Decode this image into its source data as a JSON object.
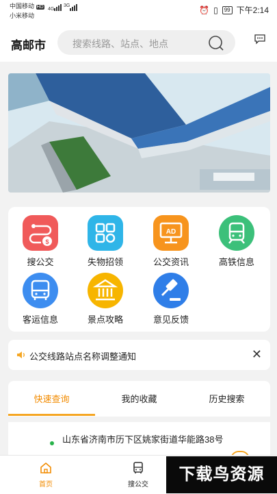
{
  "status": {
    "carrier1": "中国移动",
    "hd": "HD",
    "carrier2": "小米移动",
    "net1": "4G",
    "net2": "3G",
    "battery": "99",
    "time": "下午2:14"
  },
  "header": {
    "city": "高邮市",
    "search_placeholder": "搜索线路、站点、地点"
  },
  "grid": [
    {
      "label": "搜公交",
      "color": "#f05a5a",
      "icon": "bus-route-icon"
    },
    {
      "label": "失物招领",
      "color": "#2fb5e8",
      "icon": "lost-found-icon"
    },
    {
      "label": "公交资讯",
      "color": "#f7941d",
      "icon": "ad-news-icon"
    },
    {
      "label": "高铁信息",
      "color": "#3cc07a",
      "icon": "train-icon"
    },
    {
      "label": "客运信息",
      "color": "#3d8df0",
      "icon": "coach-icon"
    },
    {
      "label": "景点攻略",
      "color": "#f7b500",
      "icon": "temple-icon"
    },
    {
      "label": "意见反馈",
      "color": "#2f7ee8",
      "icon": "gavel-icon"
    }
  ],
  "notice": {
    "text": "公交线路站点名称调整通知"
  },
  "tabs": [
    "快速查询",
    "我的收藏",
    "历史搜索"
  ],
  "result": {
    "address": "山东省济南市历下区姚家街道华能路38号"
  },
  "nav": {
    "home": "首页",
    "bus": "搜公交"
  },
  "watermark": "下载鸟资源",
  "colors": {
    "accent": "#f5a623",
    "active_text": "#f28b00"
  }
}
